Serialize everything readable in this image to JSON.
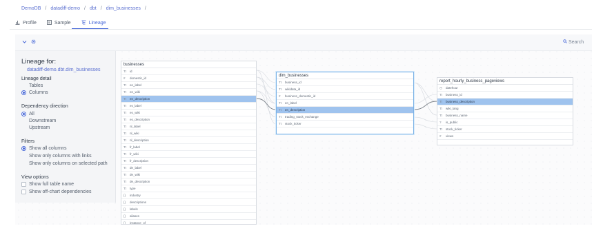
{
  "breadcrumb": [
    "DemoDB",
    "datadiff-demo",
    "dbt",
    "dim_businesses"
  ],
  "tabs": [
    {
      "label": "Profile",
      "icon": "bar-chart-icon"
    },
    {
      "label": "Sample",
      "icon": "table-icon"
    },
    {
      "label": "Lineage",
      "icon": "lineage-icon",
      "active": true
    }
  ],
  "search": {
    "placeholder": "Search"
  },
  "panel": {
    "title": "Lineage for:",
    "subtitle": "datadiff-demo.dbt.dim_businesses",
    "lineage_detail": {
      "label": "Lineage detail",
      "options": [
        {
          "label": "Tables",
          "selected": false,
          "radio": false
        },
        {
          "label": "Columns",
          "selected": true,
          "radio": true
        }
      ]
    },
    "direction": {
      "label": "Dependency direction",
      "options": [
        {
          "label": "All",
          "selected": true,
          "radio": true
        },
        {
          "label": "Downstream",
          "selected": false,
          "radio": false
        },
        {
          "label": "Upstream",
          "selected": false,
          "radio": false
        }
      ]
    },
    "filters": {
      "label": "Filters",
      "options": [
        {
          "label": "Show all columns",
          "selected": true,
          "radio": true
        },
        {
          "label": "Show only columns with links",
          "selected": false,
          "radio": false
        },
        {
          "label": "Show only columns on selected path",
          "selected": false,
          "radio": false
        }
      ]
    },
    "view_options": {
      "label": "View options",
      "options": [
        {
          "label": "Show full table name",
          "checked": false
        },
        {
          "label": "Show off-chart dependencies",
          "checked": false
        }
      ]
    }
  },
  "nodes": {
    "businesses": {
      "title": "businesses",
      "rows": [
        {
          "icon": "Tt",
          "label": "id"
        },
        {
          "icon": "#",
          "label": "domestic_id"
        },
        {
          "icon": "Tt",
          "label": "en_label"
        },
        {
          "icon": "Tt",
          "label": "en_wiki"
        },
        {
          "icon": "Tt",
          "label": "en_description",
          "selected": true
        },
        {
          "icon": "Tt",
          "label": "es_label"
        },
        {
          "icon": "Tt",
          "label": "es_wiki"
        },
        {
          "icon": "Tt",
          "label": "es_description"
        },
        {
          "icon": "Tt",
          "label": "nl_label"
        },
        {
          "icon": "Tt",
          "label": "nl_wiki"
        },
        {
          "icon": "Tt",
          "label": "nl_description"
        },
        {
          "icon": "Tt",
          "label": "fr_label"
        },
        {
          "icon": "Tt",
          "label": "fr_wiki"
        },
        {
          "icon": "Tt",
          "label": "fr_description"
        },
        {
          "icon": "Tt",
          "label": "de_label"
        },
        {
          "icon": "Tt",
          "label": "de_wiki"
        },
        {
          "icon": "Tt",
          "label": "de_description"
        },
        {
          "icon": "Tt",
          "label": "type"
        },
        {
          "icon": "{}",
          "label": "industry"
        },
        {
          "icon": "{}",
          "label": "descriptions"
        },
        {
          "icon": "{}",
          "label": "labels"
        },
        {
          "icon": "{}",
          "label": "aliases"
        },
        {
          "icon": "{}",
          "label": "instance_of"
        }
      ]
    },
    "dim_businesses": {
      "title": "dim_businesses",
      "rows": [
        {
          "icon": "Tt",
          "label": "business_id"
        },
        {
          "icon": "Tt",
          "label": "wikidata_id"
        },
        {
          "icon": "#",
          "label": "business_domestic_id"
        },
        {
          "icon": "Tt",
          "label": "en_label"
        },
        {
          "icon": "Tt",
          "label": "en_description",
          "selected": true
        },
        {
          "icon": "Tt",
          "label": "trading_stock_exchange"
        },
        {
          "icon": "Tt",
          "label": "stock_ticker"
        }
      ]
    },
    "report": {
      "title": "report_hourly_business_pageviews",
      "rows": [
        {
          "icon": "◷",
          "label": "datehour"
        },
        {
          "icon": "Tt",
          "label": "business_id"
        },
        {
          "icon": "Tt",
          "label": "business_description",
          "selected": true
        },
        {
          "icon": "Tt",
          "label": "wiki_lang"
        },
        {
          "icon": "Tt",
          "label": "business_name"
        },
        {
          "icon": "?",
          "label": "is_public"
        },
        {
          "icon": "Tt",
          "label": "stock_ticker"
        },
        {
          "icon": "#",
          "label": "views"
        }
      ]
    }
  },
  "colors": {
    "accent": "#4a6ad8",
    "selected_row": "#9fc3ee",
    "edge": "#7a8088"
  }
}
